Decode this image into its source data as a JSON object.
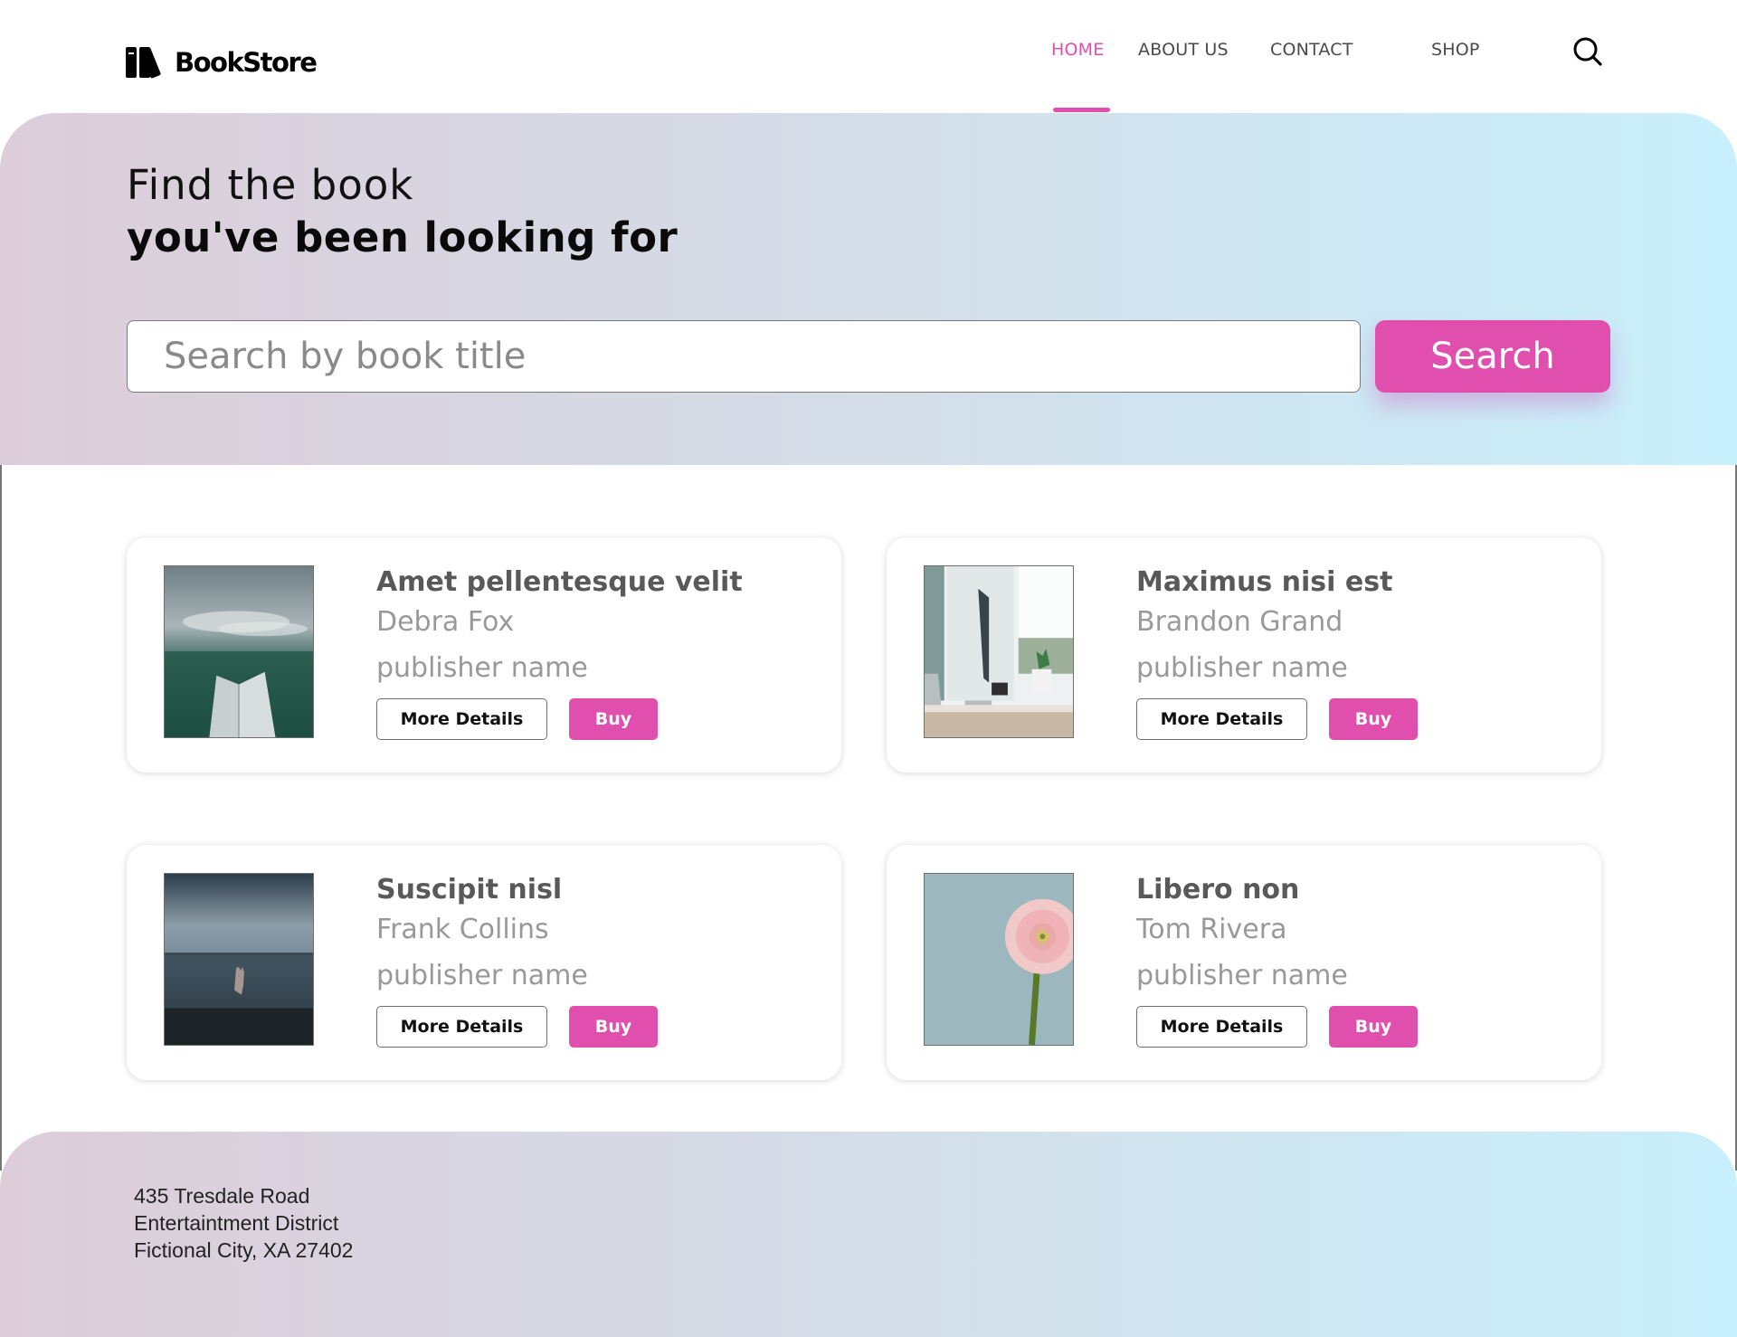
{
  "brand": {
    "name": "BookStore",
    "accent_color": "#e04fae"
  },
  "nav": {
    "items": [
      {
        "label": "HOME",
        "active": true
      },
      {
        "label": "ABOUT US",
        "active": false
      },
      {
        "label": "CONTACT",
        "active": false
      },
      {
        "label": "SHOP",
        "active": false
      }
    ],
    "search_icon": "search-icon"
  },
  "hero": {
    "line1": "Find the book",
    "line2": "you've been looking for",
    "search_placeholder": "Search by book title",
    "search_value": "",
    "search_button": "Search"
  },
  "books": [
    {
      "title": "Amet pellentesque velit",
      "author": "Debra Fox",
      "publisher": "publisher name",
      "cover": "misty-forest-open-book",
      "details_label": "More Details",
      "buy_label": "Buy"
    },
    {
      "title": "Maximus nisi est",
      "author": "Brandon Grand",
      "publisher": "publisher name",
      "cover": "desk-with-monitor-and-camera",
      "details_label": "More Details",
      "buy_label": "Buy"
    },
    {
      "title": "Suscipit nisl",
      "author": "Frank Collins",
      "publisher": "publisher name",
      "cover": "hand-rising-from-stormy-sea",
      "details_label": "More Details",
      "buy_label": "Buy"
    },
    {
      "title": "Libero non",
      "author": "Tom Rivera",
      "publisher": "publisher name",
      "cover": "pink-gerbera-flower",
      "details_label": "More Details",
      "buy_label": "Buy"
    }
  ],
  "footer": {
    "address": [
      "435 Tresdale Road",
      "Entertaintment District",
      "Fictional City, XA 27402"
    ]
  }
}
